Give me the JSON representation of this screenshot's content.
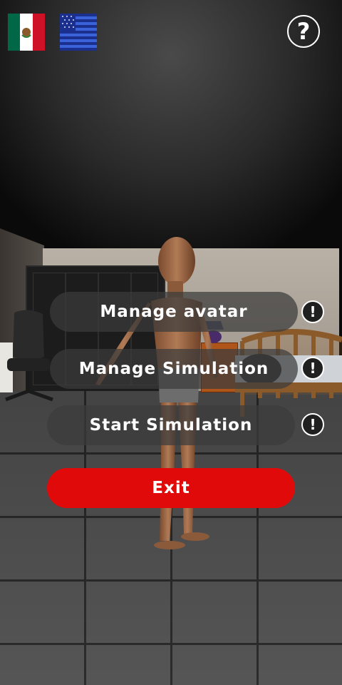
{
  "languages": [
    {
      "name": "mexico-flag",
      "colors": [
        "#006847",
        "#ffffff",
        "#ce1126"
      ]
    },
    {
      "name": "usa-flag",
      "colors": [
        "#3b63d9",
        "#1b2f8f",
        "#ffffff"
      ]
    }
  ],
  "help": {
    "symbol": "?"
  },
  "menu": {
    "manage_avatar": "Manage avatar",
    "manage_simulation": "Manage Simulation",
    "start_simulation": "Start Simulation",
    "exit": "Exit"
  },
  "info_icon": {
    "symbol": "!"
  },
  "colors": {
    "exit_button": "#e00a0a",
    "menu_button": "rgba(60,60,60,0.72)",
    "text": "#ffffff"
  }
}
